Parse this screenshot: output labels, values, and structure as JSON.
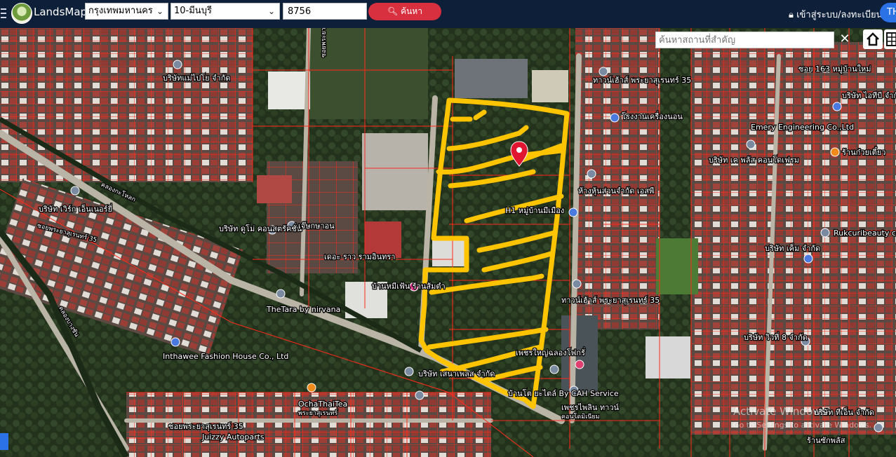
{
  "app": {
    "name": "LandsMaps"
  },
  "header": {
    "province": "กรุงเทพมหานคร",
    "district": "10-มีนบุรี",
    "parcel_number": "8756",
    "search_label": "ค้นหา",
    "login_label": "เข้าสู่ระบบ/ลงทะเบียน",
    "language": "TH"
  },
  "map": {
    "place_search_placeholder": "ค้นหาสถานที่สำคัญ",
    "labels": {
      "company_top_left": "บริษัทแม่ไปโย จำกัด",
      "road_top": "ซอยพระยาสุเรนทร์ 35",
      "canal": "คลองกะโหลก",
      "company_left": "บริษัท เวิร์ก เอ็นเนอร์ยี่",
      "company_left_2": "ซอยพระยาสุเรนทร์ 35",
      "company_mid": "บริษัท ดูโม่ คอนสตรัคชั่น",
      "shop_mid": "เจ๊ษกษาอน",
      "park": "เดอะ ราว รามอินทรา",
      "shop_mid2": "บ้านหมีเฟ้น ร้านส้มตำ",
      "thetara": "TheTara by nirvana",
      "canal_left": "คลองบางชัน",
      "inthawee": "Inthawee Fashion House Co., Ltd",
      "ochathai": "OchaThaiTea",
      "ochathai_2": "พระยาสุเรนทร์",
      "road_bottom": "ซอยพระยาสุเรนทร์ 35",
      "juizzy": "Juizzy Autoparts",
      "company_bottom": "บริษัท เสนาเพลส จำกัด",
      "shop_bottom": "เพชรใหญ่ฉลองโฟกรั่",
      "by_cah": "บ้านโต ยะไตล์ By CAH Service",
      "town_bottom": "เพชรไพลิน ทาวน์",
      "town_bottom_2": "คอนโดมิเนียม",
      "hi_village": "H1 หมู่บ้านมีเมือง",
      "community_right": "ทาวน์เฮ้าส์ พระยาสุเรนทร์ 35",
      "factory_right": "โรงงานเครื่องนอน",
      "company_right": "ห้างหุ้นส่วนจำกัด เอสพี",
      "town_right2": "ทาวน์เฮ้าส์ พระยาสุเรนทร์ 35",
      "emery": "Emery Engineering Co.,Ltd",
      "shop_right": "บริษัท เค พลัส คอนโดเฟรม",
      "noodle": "ร้านก๋วยเตี๋ยว",
      "rukcuri": "Rukcuribeauty co",
      "company_right3": "บริษัท วิวที่ 8 จำกัด",
      "company_top_right": "ซอย 163 หมู่บ้านใหม่",
      "company_top_right2": "บริษัท ไอทีบี จำกัด",
      "company_right4": "บริษัท เค็ม จำกัด",
      "company_right5": "บริษัท ทีเอ็น จำกัด",
      "shop_right_bottom": "ร้านซักพลัส"
    },
    "watermark": "Activate Windows",
    "watermark_sub": "Go to Settings to activate Windows.",
    "colors": {
      "boundary": "#ff2a1a",
      "highlight": "#ffc400",
      "pin": "#e01530"
    }
  }
}
